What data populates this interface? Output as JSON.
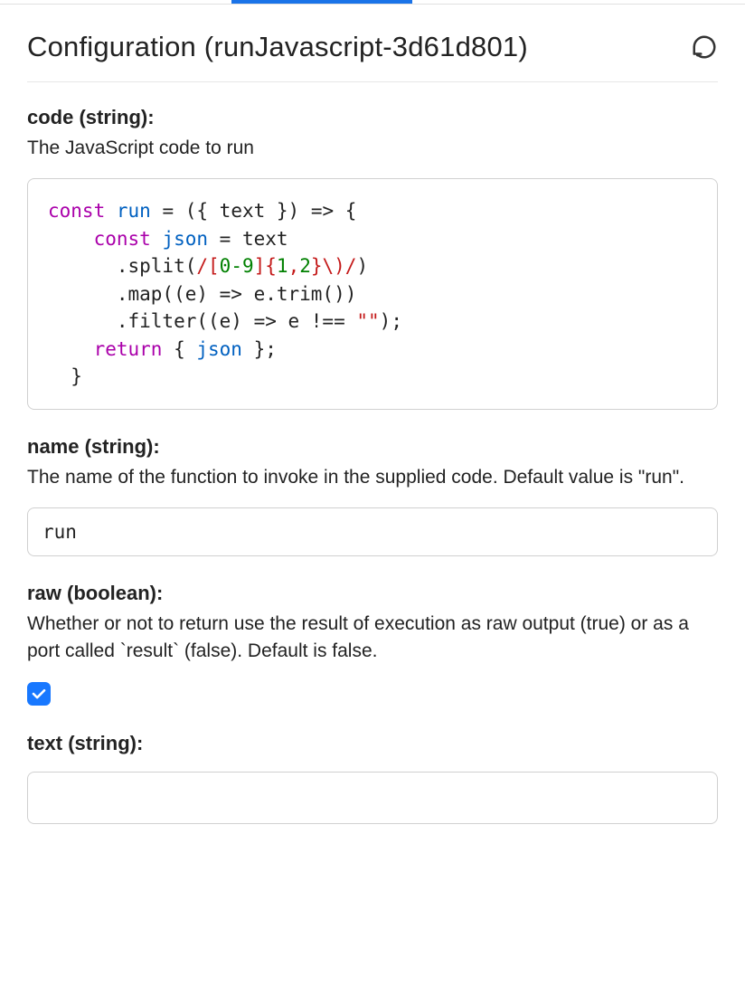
{
  "panel": {
    "title": "Configuration (runJavascript-3d61d801)"
  },
  "fields": {
    "code": {
      "label": "code (string):",
      "description": "The JavaScript code to run",
      "tokens": {
        "kw_const": "const",
        "run": "run",
        "eq_open": " = ({ text }) => {",
        "json": "json",
        "assign_text": " = text",
        "dot_split": ".split(",
        "regex_open": "/[",
        "regex_digits": "0-9",
        "regex_mid": "]{",
        "regex_q1": "1",
        "regex_comma": ",",
        "regex_q2": "2",
        "regex_close": "}\\)/",
        "close_paren": ")",
        "dot_map": ".map((e) => e.trim())",
        "dot_filter_pre": ".filter((e) => e !== ",
        "empty_str": "\"\"",
        "filter_end": ");",
        "kw_return": "return",
        "ret_open": " { ",
        "ret_close": " };",
        "brace_close": "}"
      }
    },
    "name": {
      "label": "name (string):",
      "description": "The name of the function to invoke in the supplied code. Default value is \"run\".",
      "value": "run"
    },
    "raw": {
      "label": "raw (boolean):",
      "description": "Whether or not to return use the result of execution as raw output (true) or as a port called `result` (false). Default is false.",
      "checked": true
    },
    "text": {
      "label": "text (string):",
      "value": ""
    }
  }
}
